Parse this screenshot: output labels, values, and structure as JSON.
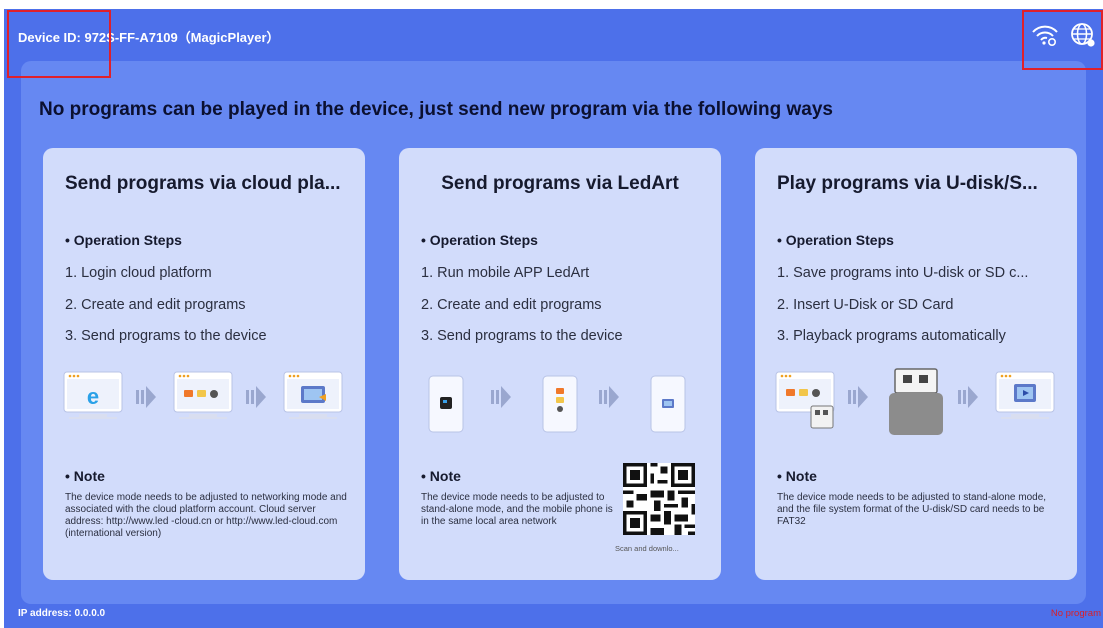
{
  "header": {
    "device_id": "Device ID: 972S-FF-A7109（MagicPlayer）",
    "icons": [
      "wifi-icon",
      "globe-icon"
    ]
  },
  "main": {
    "headline": "No programs can be played in the device, just send new program via the following ways",
    "cards": [
      {
        "title": "Send programs via cloud pla...",
        "steps_heading": "• Operation Steps",
        "steps": [
          "1. Login cloud platform",
          "2. Create and edit programs",
          "3. Send programs to the device"
        ],
        "note_heading": "• Note",
        "note": "The device mode needs to be adjusted to networking mode and associated with the cloud platform account. Cloud server address: http://www.led -cloud.cn or http://www.led-cloud.com (international version)"
      },
      {
        "title": "Send programs via LedArt",
        "steps_heading": "• Operation Steps",
        "steps": [
          "1. Run mobile APP LedArt",
          "2. Create and edit programs",
          "3. Send programs to the device"
        ],
        "note_heading": "• Note",
        "note": "The device mode needs to be adjusted to stand-alone mode, and the mobile phone is in the same local area network",
        "qr_caption": "Scan and downlo..."
      },
      {
        "title": "Play programs via U-disk/S...",
        "steps_heading": "• Operation Steps",
        "steps": [
          "1. Save programs into U-disk or SD c...",
          "2. Insert U-Disk or SD Card",
          "3. Playback programs automatically"
        ],
        "note_heading": "• Note",
        "note": "The device mode needs to be adjusted to stand-alone mode, and the file system format of the U-disk/SD card needs to be FAT32"
      }
    ]
  },
  "footer": {
    "ip": "IP address: 0.0.0.0",
    "status": "No program"
  },
  "colors": {
    "background": "#4d70ea",
    "panel": "#6688f2",
    "card": "#d2dcfb",
    "annotation": "#e0202a",
    "status_text": "#d8202a"
  }
}
